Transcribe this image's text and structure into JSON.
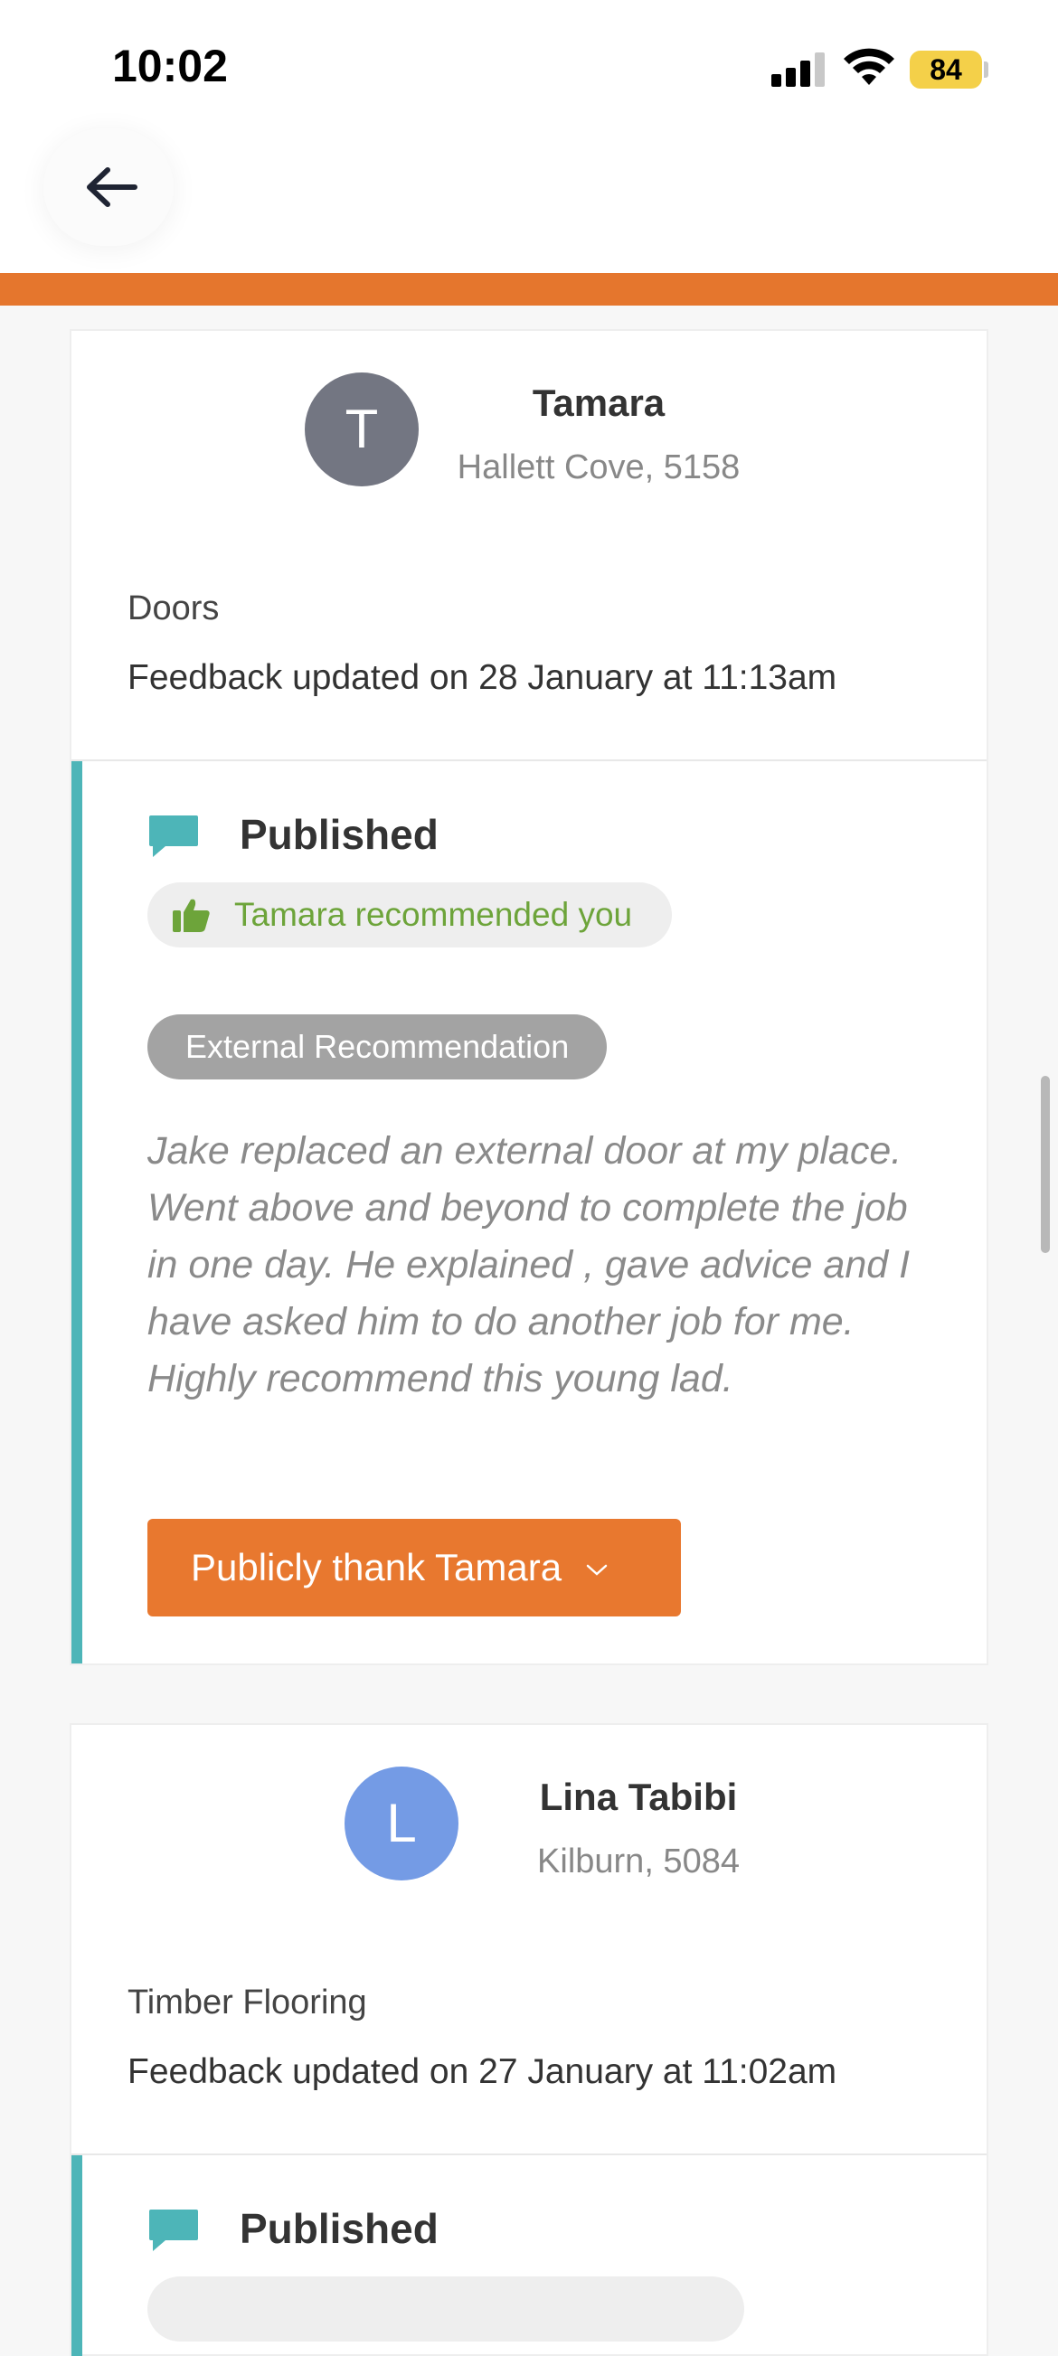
{
  "status_bar": {
    "time": "10:02",
    "battery": "84"
  },
  "nav": {
    "back_icon": "arrow-left-icon"
  },
  "colors": {
    "accent": "#e5762d",
    "teal": "#4db5b8",
    "green": "#6da43a"
  },
  "reviews": [
    {
      "avatar_letter": "T",
      "avatar_color": "#737682",
      "name": "Tamara",
      "location": "Hallett Cove, 5158",
      "category": "Doors",
      "updated": "Feedback updated on 28 January at 11:13am",
      "status": "Published",
      "recommendation": "Tamara recommended you",
      "badge": "External Recommendation",
      "text": "Jake replaced an external door at my place. Went above and beyond to complete the job in one day. He explained , gave advice and I have asked him to do another job for me. Highly recommend this young lad.",
      "thank_button": "Publicly thank Tamara"
    },
    {
      "avatar_letter": "L",
      "avatar_color": "#749be5",
      "name": "Lina Tabibi",
      "location": "Kilburn, 5084",
      "category": "Timber Flooring",
      "updated": "Feedback updated on 27 January at 11:02am",
      "status": "Published"
    }
  ]
}
